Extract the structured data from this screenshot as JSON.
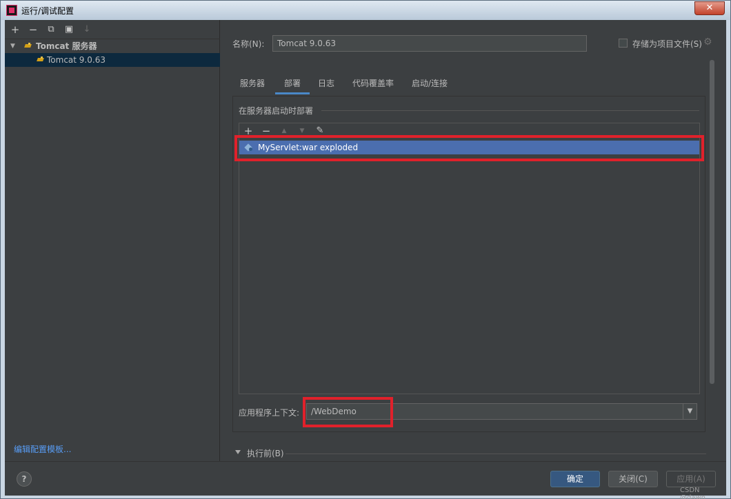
{
  "window": {
    "title": "运行/调试配置",
    "close_symbol": "✕"
  },
  "left_panel": {
    "toolbar": {
      "add": "+",
      "remove": "−",
      "copy": "⧉",
      "folder": "▣",
      "sort": "↓"
    },
    "tree": [
      {
        "label": "Tomcat 服务器",
        "expanded": true
      },
      {
        "label": "Tomcat 9.0.63",
        "selected": true
      }
    ],
    "edit_templates_link": "编辑配置模板..."
  },
  "form": {
    "name_label": "名称(N):",
    "name_value": "Tomcat 9.0.63",
    "store_as_project_file_label": "存储为项目文件(S)",
    "store_as_project_file_checked": false
  },
  "tabs": [
    {
      "label": "服务器",
      "active": false
    },
    {
      "label": "部署",
      "active": true
    },
    {
      "label": "日志",
      "active": false
    },
    {
      "label": "代码覆盖率",
      "active": false
    },
    {
      "label": "启动/连接",
      "active": false
    }
  ],
  "deployment": {
    "section_title": "在服务器启动时部署",
    "toolbar": {
      "add": "+",
      "remove": "−",
      "up": "▲",
      "down": "▼",
      "edit": "✎"
    },
    "artifacts": [
      {
        "label": "MyServlet:war exploded",
        "selected": true
      }
    ],
    "context_label": "应用程序上下文:",
    "context_value": "/WebDemo"
  },
  "before_launch": {
    "label": "执行前(B)",
    "collapsed": true
  },
  "buttons": {
    "help": "?",
    "ok": "确定",
    "close": "关闭(C)",
    "apply": "应用(A)",
    "apply_enabled": false
  },
  "watermark": "CSDN @dawn",
  "colors": {
    "annotation": "#e0212b",
    "selection": "#4b6eaf",
    "primary_button": "#365880",
    "link": "#589df6"
  }
}
